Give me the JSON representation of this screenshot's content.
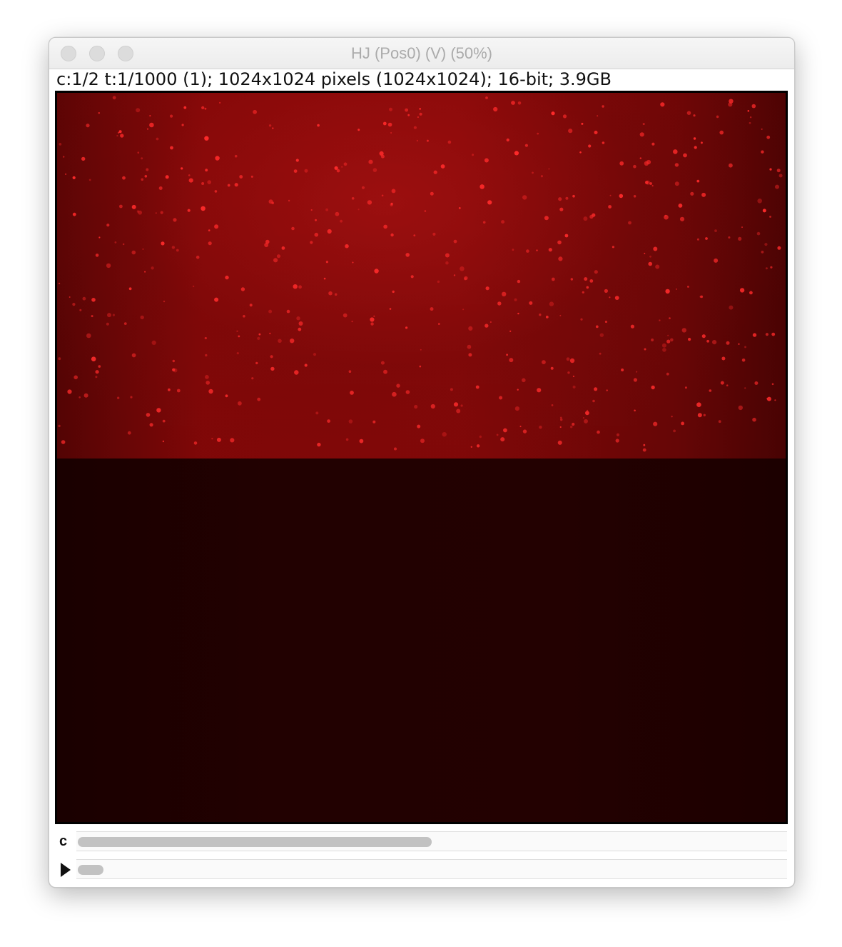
{
  "window": {
    "title": "HJ (Pos0) (V) (50%)",
    "info": "c:1/2 t:1/1000 (1); 1024x1024 pixels (1024x1024); 16-bit; 3.9GB"
  },
  "image": {
    "colormap": "red",
    "top_half_color": "#8a0808",
    "bottom_half_color": "#220101",
    "spot_color": "#ff2a2a"
  },
  "sliders": {
    "channel": {
      "label": "c",
      "position_fraction": 0.5
    },
    "time": {
      "icon": "play-icon",
      "position_fraction": 0.001
    }
  }
}
